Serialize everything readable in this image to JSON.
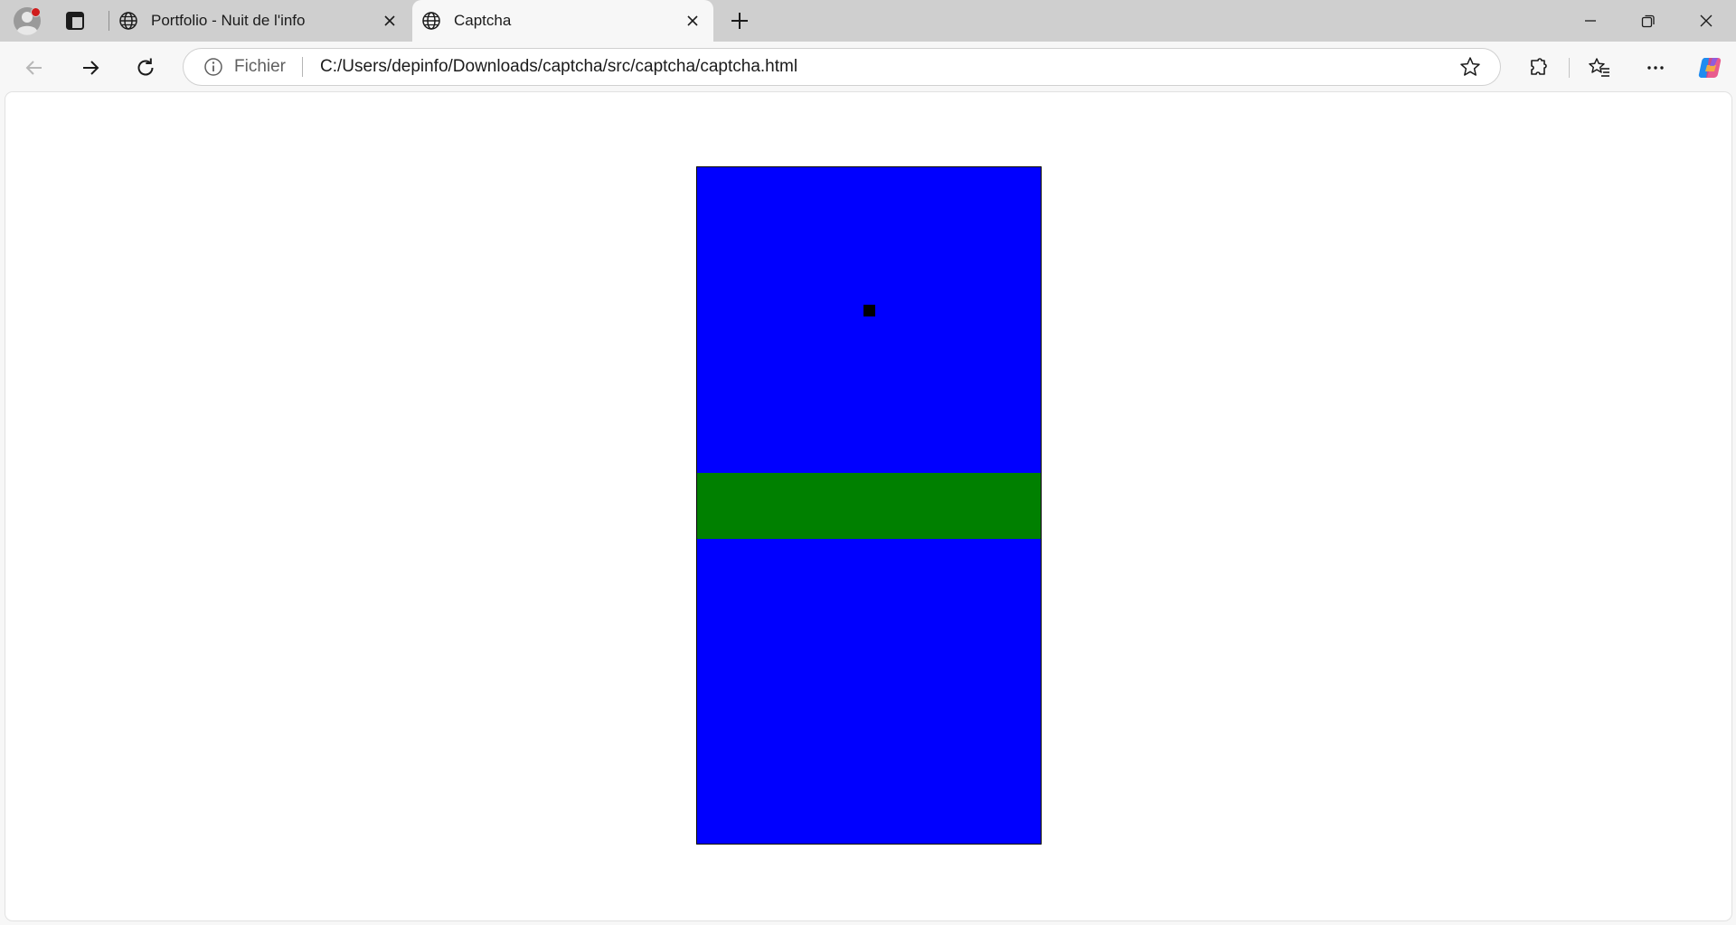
{
  "browser": {
    "tabs": [
      {
        "title": "Portfolio - Nuit de l'info",
        "icon": "globe-icon",
        "active": false
      },
      {
        "title": "Captcha",
        "icon": "globe-icon",
        "active": true
      }
    ],
    "address_bar": {
      "scheme_label": "Fichier",
      "url": "C:/Users/depinfo/Downloads/captcha/src/captcha/captcha.html"
    }
  },
  "captcha": {
    "colors": {
      "background_zone": "#0000ff",
      "target_zone": "#008000",
      "player": "#000000",
      "border": "#000000"
    }
  }
}
